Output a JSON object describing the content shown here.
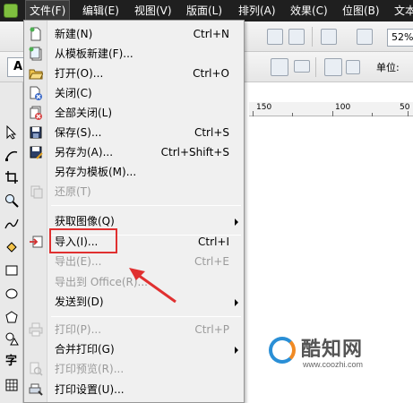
{
  "menubar": {
    "items": [
      "文件(F)",
      "编辑(E)",
      "视图(V)",
      "版面(L)",
      "排列(A)",
      "效果(C)",
      "位图(B)",
      "文本"
    ]
  },
  "toolbar": {
    "zoom": "52%",
    "font_button": "A",
    "unit_label": "单位:"
  },
  "ruler": {
    "labels": [
      "150",
      "100",
      "50"
    ]
  },
  "toolbox": {
    "text_tool_label": "字"
  },
  "file_menu": {
    "items": [
      {
        "label": "新建(N)",
        "shortcut": "Ctrl+N",
        "icon": "new-document-icon",
        "enabled": true,
        "submenu": false
      },
      {
        "label": "从模板新建(F)...",
        "shortcut": "",
        "icon": "new-from-template-icon",
        "enabled": true,
        "submenu": false
      },
      {
        "label": "打开(O)...",
        "shortcut": "Ctrl+O",
        "icon": "open-folder-icon",
        "enabled": true,
        "submenu": false
      },
      {
        "label": "关闭(C)",
        "shortcut": "",
        "icon": "close-document-icon",
        "enabled": true,
        "submenu": false
      },
      {
        "label": "全部关闭(L)",
        "shortcut": "",
        "icon": "close-all-icon",
        "enabled": true,
        "submenu": false
      },
      {
        "label": "保存(S)...",
        "shortcut": "Ctrl+S",
        "icon": "save-icon",
        "enabled": true,
        "submenu": false
      },
      {
        "label": "另存为(A)...",
        "shortcut": "Ctrl+Shift+S",
        "icon": "save-as-icon",
        "enabled": true,
        "submenu": false
      },
      {
        "label": "另存为模板(M)...",
        "shortcut": "",
        "icon": "",
        "enabled": true,
        "submenu": false
      },
      {
        "label": "还原(T)",
        "shortcut": "",
        "icon": "revert-icon",
        "enabled": false,
        "submenu": false
      },
      {
        "label": "获取图像(Q)",
        "shortcut": "",
        "icon": "",
        "enabled": true,
        "submenu": true
      },
      {
        "label": "导入(I)...",
        "shortcut": "Ctrl+I",
        "icon": "import-icon",
        "enabled": true,
        "submenu": false
      },
      {
        "label": "导出(E)...",
        "shortcut": "Ctrl+E",
        "icon": "",
        "enabled": false,
        "submenu": false
      },
      {
        "label": "导出到 Office(R)...",
        "shortcut": "",
        "icon": "",
        "enabled": false,
        "submenu": false
      },
      {
        "label": "发送到(D)",
        "shortcut": "",
        "icon": "",
        "enabled": true,
        "submenu": true
      },
      {
        "label": "打印(P)...",
        "shortcut": "Ctrl+P",
        "icon": "print-icon",
        "enabled": false,
        "submenu": false
      },
      {
        "label": "合并打印(G)",
        "shortcut": "",
        "icon": "",
        "enabled": true,
        "submenu": true
      },
      {
        "label": "打印预览(R)...",
        "shortcut": "",
        "icon": "print-preview-icon",
        "enabled": false,
        "submenu": false
      },
      {
        "label": "打印设置(U)...",
        "shortcut": "",
        "icon": "print-setup-icon",
        "enabled": true,
        "submenu": false
      }
    ]
  },
  "watermark": {
    "brand": "酷知网",
    "url": "www.coozhi.com"
  },
  "colors": {
    "menubar_bg": "#1f1f1f",
    "highlight": "#e03030",
    "disabled_text": "#9a9a9a"
  }
}
